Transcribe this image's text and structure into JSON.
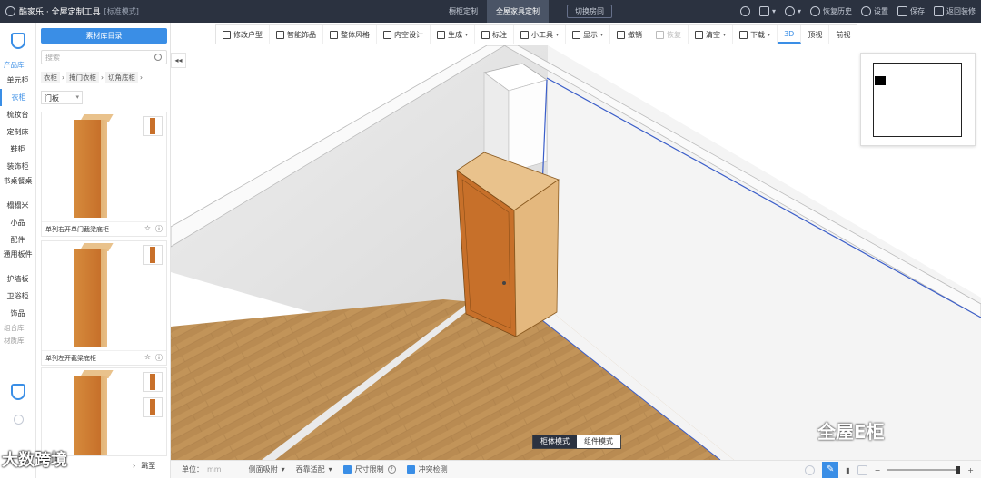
{
  "app": {
    "brand": "酷家乐 · 全屋定制工具",
    "mode": "[标准模式]",
    "tabs": [
      "橱柜定制",
      "全屋家具定制"
    ],
    "active_tab": "全屋家具定制",
    "switch_room": "切换房间",
    "right_menu": [
      "恢复历史",
      "设置",
      "保存",
      "返回装修"
    ]
  },
  "rail": {
    "section_products": "产品库",
    "items": [
      "单元柜",
      "衣柜",
      "梳妆台",
      "定制床",
      "鞋柜",
      "装饰柜",
      "书桌餐桌",
      "榻榻米",
      "小品",
      "配件",
      "通用板件",
      "护墙板",
      "卫浴柜",
      "饰品"
    ],
    "active": "衣柜",
    "section_combo": "组合库",
    "section_material": "材质库"
  },
  "panel": {
    "catalog_button": "素材库目录",
    "search_placeholder": "搜索",
    "breadcrumbs": [
      "衣柜",
      "掩门衣柜",
      "切角底柜"
    ],
    "filter": "门板",
    "cards": [
      {
        "label": "单列右开单门截梁底柜"
      },
      {
        "label": "单列左开截梁底柜"
      },
      {
        "label": ""
      }
    ],
    "pager_next": "跳至"
  },
  "toolbar": {
    "items": [
      "修改户型",
      "智能饰品",
      "整体风格",
      "内空设计",
      "生成",
      "标注",
      "小工具",
      "显示",
      "撤销",
      "恢复",
      "清空",
      "下载"
    ],
    "views": [
      "3D",
      "顶视",
      "前视"
    ],
    "active_view": "3D"
  },
  "viewport": {
    "mode_options": [
      "柜体模式",
      "组件模式"
    ],
    "active_mode": "柜体模式"
  },
  "statusbar": {
    "unit_label": "单位：",
    "unit_value": "mm",
    "items": [
      "侧面吸附",
      "吞靠适配",
      "尺寸限制",
      "冲突检测"
    ]
  },
  "watermark": {
    "left": "大数跨境",
    "right": "全屋E柜"
  },
  "colors": {
    "accent": "#3a8ee6",
    "topbar": "#2b3240",
    "wood_floor": "#b98b52",
    "cabinet": "#c7702a"
  }
}
